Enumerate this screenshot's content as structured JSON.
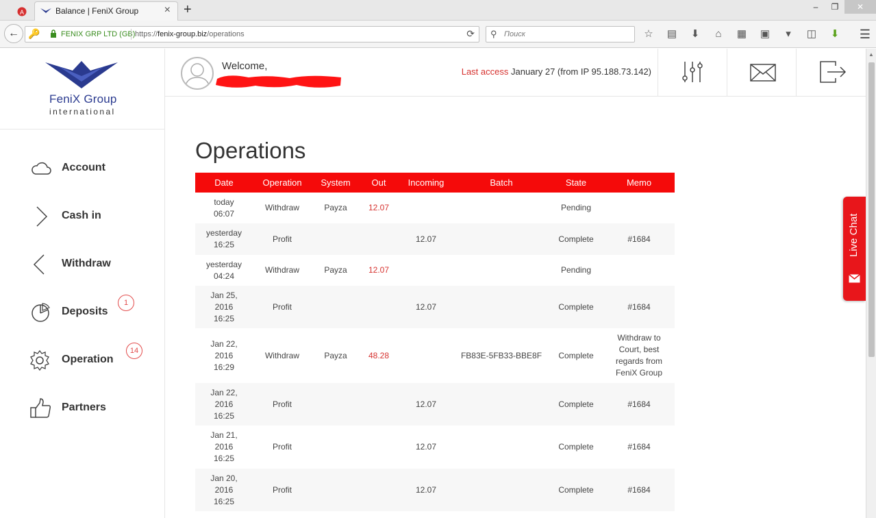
{
  "browser": {
    "tab_title": "Balance | FeniX Group",
    "url_org": "FENIX GRP LTD (GB)",
    "url_prefix": "https://",
    "url_host": "fenix-group.biz",
    "url_path": "/operations",
    "search_placeholder": "Поиск"
  },
  "sidebar": {
    "logo_name": "FeniX Group",
    "logo_sub": "international",
    "items": [
      {
        "label": "Account",
        "icon": "cloud-icon",
        "badge": ""
      },
      {
        "label": "Cash in",
        "icon": "chevron-right-icon",
        "badge": ""
      },
      {
        "label": "Withdraw",
        "icon": "chevron-left-icon",
        "badge": ""
      },
      {
        "label": "Deposits",
        "icon": "pie-chart-icon",
        "badge": "1"
      },
      {
        "label": "Operation",
        "icon": "gear-icon",
        "badge": "14"
      },
      {
        "label": "Partners",
        "icon": "thumbs-up-icon",
        "badge": ""
      }
    ]
  },
  "header": {
    "welcome": "Welcome,",
    "last_access_label": "Last access",
    "last_access_value": "January 27 (from IP 95.188.73.142)"
  },
  "main": {
    "title": "Operations",
    "columns": [
      "Date",
      "Operation",
      "System",
      "Out",
      "Incoming",
      "Batch",
      "State",
      "Memo"
    ],
    "rows": [
      {
        "date": [
          "today",
          "06:07"
        ],
        "operation": "Withdraw",
        "system": "Payza",
        "out": "12.07",
        "incoming": "",
        "batch": "",
        "state": "Pending",
        "memo": []
      },
      {
        "date": [
          "yesterday",
          "16:25"
        ],
        "operation": "Profit",
        "system": "",
        "out": "",
        "incoming": "12.07",
        "batch": "",
        "state": "Complete",
        "memo": [
          "#1684"
        ]
      },
      {
        "date": [
          "yesterday",
          "04:24"
        ],
        "operation": "Withdraw",
        "system": "Payza",
        "out": "12.07",
        "incoming": "",
        "batch": "",
        "state": "Pending",
        "memo": []
      },
      {
        "date": [
          "Jan 25,",
          "2016",
          "16:25"
        ],
        "operation": "Profit",
        "system": "",
        "out": "",
        "incoming": "12.07",
        "batch": "",
        "state": "Complete",
        "memo": [
          "#1684"
        ]
      },
      {
        "date": [
          "Jan 22,",
          "2016",
          "16:29"
        ],
        "operation": "Withdraw",
        "system": "Payza",
        "out": "48.28",
        "incoming": "",
        "batch": "FB83E-5FB33-BBE8F",
        "state": "Complete",
        "memo": [
          "Withdraw to",
          "Court, best",
          "regards from",
          "FeniX Group"
        ]
      },
      {
        "date": [
          "Jan 22,",
          "2016",
          "16:25"
        ],
        "operation": "Profit",
        "system": "",
        "out": "",
        "incoming": "12.07",
        "batch": "",
        "state": "Complete",
        "memo": [
          "#1684"
        ]
      },
      {
        "date": [
          "Jan 21,",
          "2016",
          "16:25"
        ],
        "operation": "Profit",
        "system": "",
        "out": "",
        "incoming": "12.07",
        "batch": "",
        "state": "Complete",
        "memo": [
          "#1684"
        ]
      },
      {
        "date": [
          "Jan 20,",
          "2016",
          "16:25"
        ],
        "operation": "Profit",
        "system": "",
        "out": "",
        "incoming": "12.07",
        "batch": "",
        "state": "Complete",
        "memo": [
          "#1684"
        ]
      }
    ]
  },
  "livechat": {
    "label": "Live Chat"
  },
  "colors": {
    "accent": "#f50a0a",
    "brand": "#2a3a8f"
  }
}
